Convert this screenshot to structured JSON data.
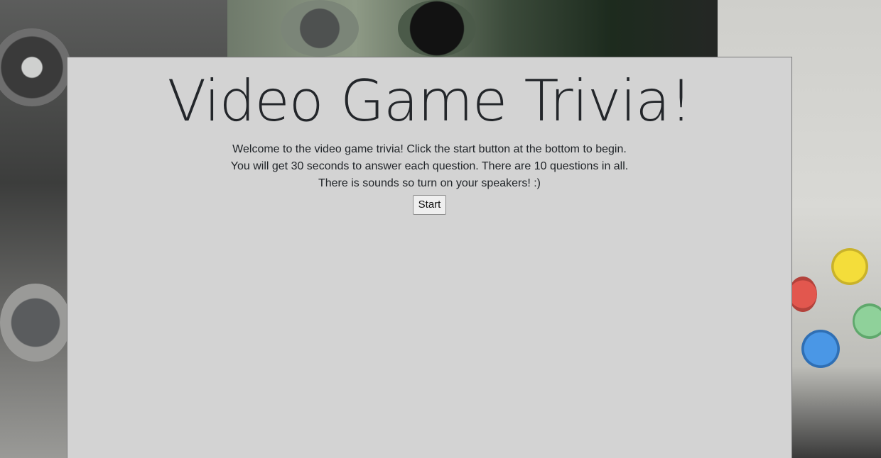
{
  "page": {
    "title": "Video Game Trivia!",
    "intro_lines": [
      "Welcome to the video game trivia! Click the start button at the bottom to begin.",
      "You will get 30 seconds to answer each question. There are 10 questions in all.",
      "There is sounds so turn on your speakers! :)"
    ],
    "start_label": "Start"
  },
  "colors": {
    "panel_background": "#d3d3d3",
    "text": "#212529"
  }
}
